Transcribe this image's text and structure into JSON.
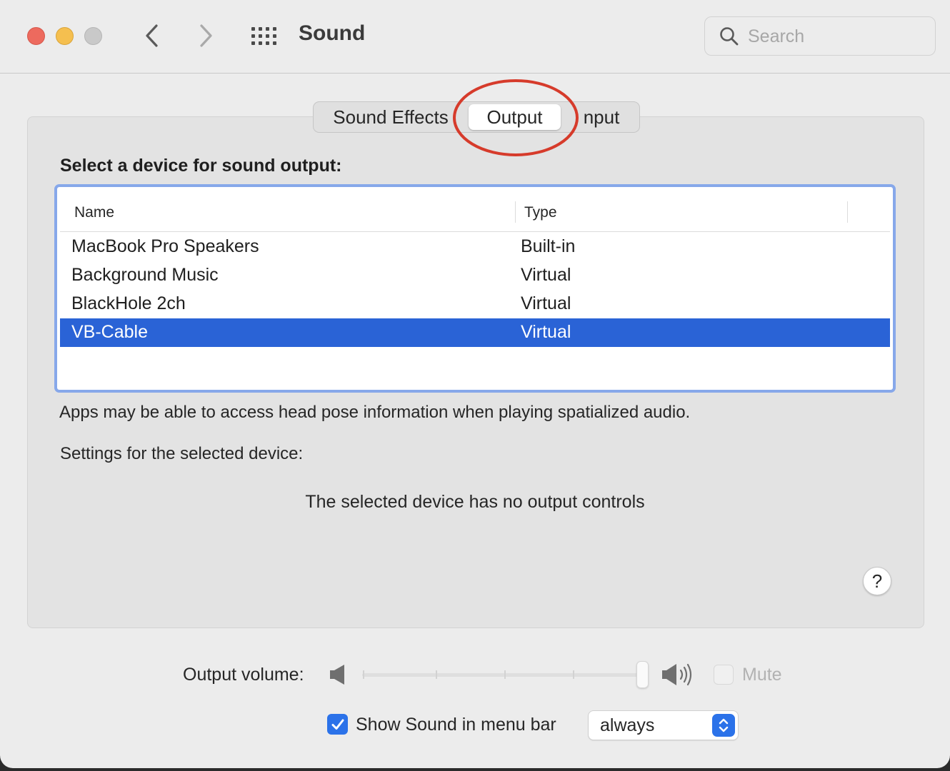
{
  "window": {
    "title": "Sound",
    "icons": {
      "back": "chevron-left-icon",
      "forward": "chevron-right-icon",
      "grid": "grid-icon",
      "search": "search-icon"
    }
  },
  "search": {
    "placeholder": "Search",
    "value": ""
  },
  "tabs": [
    {
      "label": "Sound Effects",
      "selected": false
    },
    {
      "label": "Output",
      "selected": true
    },
    {
      "label": "Input",
      "selected": false
    }
  ],
  "tab_input_visible_text": "nput",
  "annotation": {
    "shape": "ellipse",
    "color": "#d63b2b",
    "target": "Output tab"
  },
  "device_list": {
    "heading": "Select a device for sound output:",
    "columns": {
      "name": "Name",
      "type": "Type"
    },
    "rows": [
      {
        "name": "MacBook Pro Speakers",
        "type": "Built-in",
        "selected": false
      },
      {
        "name": "Background Music",
        "type": "Virtual",
        "selected": false
      },
      {
        "name": "BlackHole 2ch",
        "type": "Virtual",
        "selected": false
      },
      {
        "name": "VB-Cable",
        "type": "Virtual",
        "selected": true
      }
    ]
  },
  "note": "Apps may be able to access head pose information when playing spatialized audio.",
  "settings": {
    "label": "Settings for the selected device:",
    "message": "The selected device has no output controls",
    "help_label": "?"
  },
  "volume": {
    "label": "Output volume:",
    "level": 1.0,
    "enabled": false,
    "mute_label": "Mute",
    "mute_checked": false
  },
  "menu_bar": {
    "label": "Show Sound in menu bar",
    "checked": true,
    "select_value": "always"
  },
  "colors": {
    "accent": "#2b72e9",
    "selection": "#2a63d6",
    "focus_ring": "#87a8ea",
    "traffic_close": "#ed6a5e",
    "traffic_min": "#f5bf4f"
  }
}
